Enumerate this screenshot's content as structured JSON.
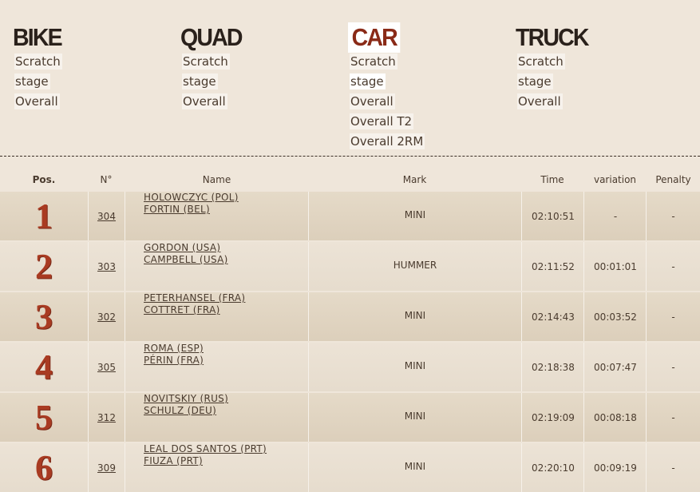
{
  "categories": [
    {
      "title": "BIKE",
      "links": [
        "Scratch",
        "stage",
        "Overall"
      ],
      "active": false,
      "selected": -1
    },
    {
      "title": "QUAD",
      "links": [
        "Scratch",
        "stage",
        "Overall"
      ],
      "active": false,
      "selected": -1
    },
    {
      "title": "CAR",
      "links": [
        "Scratch",
        "stage",
        "Overall",
        "Overall T2",
        "Overall 2RM"
      ],
      "active": true,
      "selected": 1
    },
    {
      "title": "TRUCK",
      "links": [
        "Scratch",
        "stage",
        "Overall"
      ],
      "active": false,
      "selected": -1
    }
  ],
  "table": {
    "headers": {
      "pos": "Pos.",
      "number": "N°",
      "name": "Name",
      "mark": "Mark",
      "time": "Time",
      "variation": "variation",
      "penalty": "Penalty"
    },
    "rows": [
      {
        "pos": "1",
        "number": "304",
        "driver": "HOLOWCZYC (POL)",
        "codriver": "FORTIN (BEL)",
        "mark": "MINI",
        "time": "02:10:51",
        "variation": "-",
        "penalty": "-"
      },
      {
        "pos": "2",
        "number": "303",
        "driver": "GORDON (USA)",
        "codriver": "CAMPBELL (USA)",
        "mark": "HUMMER",
        "time": "02:11:52",
        "variation": "00:01:01",
        "penalty": "-"
      },
      {
        "pos": "3",
        "number": "302",
        "driver": "PETERHANSEL (FRA)",
        "codriver": "COTTRET (FRA)",
        "mark": "MINI",
        "time": "02:14:43",
        "variation": "00:03:52",
        "penalty": "-"
      },
      {
        "pos": "4",
        "number": "305",
        "driver": "ROMA (ESP)",
        "codriver": "PÉRIN (FRA)",
        "mark": "MINI",
        "time": "02:18:38",
        "variation": "00:07:47",
        "penalty": "-"
      },
      {
        "pos": "5",
        "number": "312",
        "driver": "NOVITSKIY (RUS)",
        "codriver": "SCHULZ (DEU)",
        "mark": "MINI",
        "time": "02:19:09",
        "variation": "00:08:18",
        "penalty": "-"
      },
      {
        "pos": "6",
        "number": "309",
        "driver": "LEAL DOS SANTOS (PRT)",
        "codriver": "FIUZA (PRT)",
        "mark": "MINI",
        "time": "02:20:10",
        "variation": "00:09:19",
        "penalty": "-"
      }
    ]
  }
}
